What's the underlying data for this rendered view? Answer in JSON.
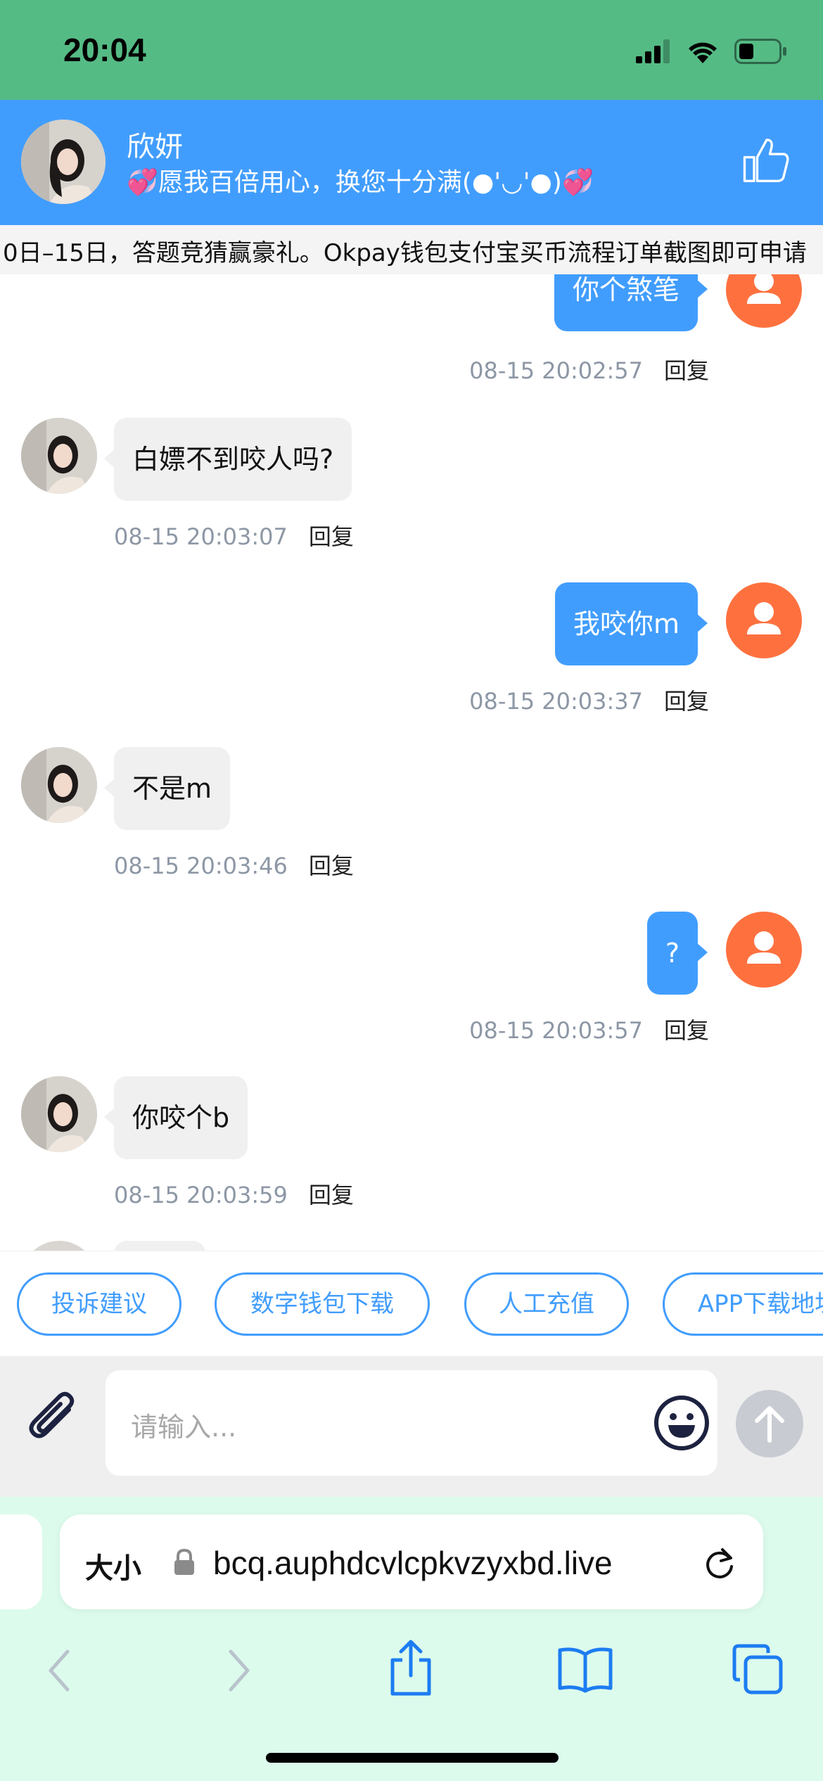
{
  "status_bar": {
    "time": "20:04",
    "bg_color": "#55bb85"
  },
  "header": {
    "name": "欣妍",
    "subtitle": "💞愿我百倍用心，换您十分满(●'◡'●)💞",
    "like_icon": "thumbs-up-icon",
    "bg_color": "#419dfd"
  },
  "marquee": {
    "text": "0日–15日，答题竞猜赢豪礼。Okpay钱包支付宝买币流程订单截图即可申请"
  },
  "messages": [
    {
      "side": "out",
      "text": "你个煞笔",
      "time": "08-15 20:02:57",
      "reply": "回复"
    },
    {
      "side": "in",
      "text": "白嫖不到咬人吗?",
      "time": "08-15 20:03:07",
      "reply": "回复"
    },
    {
      "side": "out",
      "text": "我咬你m",
      "time": "08-15 20:03:37",
      "reply": "回复"
    },
    {
      "side": "in",
      "text": "不是m",
      "time": "08-15 20:03:46",
      "reply": "回复"
    },
    {
      "side": "out",
      "text": "?",
      "time": "08-15 20:03:57",
      "reply": "回复"
    },
    {
      "side": "in",
      "text": "你咬个b",
      "time": "08-15 20:03:59",
      "reply": "回复"
    }
  ],
  "quick_actions": [
    "投诉建议",
    "数字钱包下载",
    "人工充值",
    "APP下载地址"
  ],
  "composer": {
    "placeholder": "请输入..."
  },
  "browser": {
    "text_size_label": "大小",
    "url": "bcq.auphdcvlcpkvzyxbd.live"
  },
  "accent_color": "#419dfd",
  "user_avatar_color": "#fe713f"
}
